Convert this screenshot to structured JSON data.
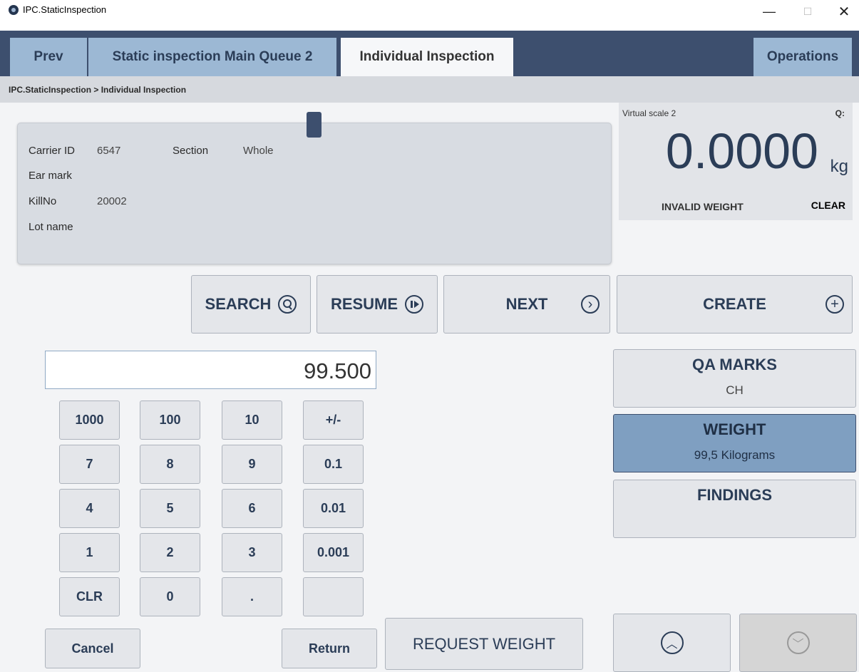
{
  "window": {
    "title": "IPC.StaticInspection",
    "minimize": "—",
    "maximize": "☐",
    "close": "✕"
  },
  "tabs": {
    "prev": "Prev",
    "queue": "Static inspection Main Queue 2",
    "individual": "Individual Inspection",
    "operations": "Operations"
  },
  "breadcrumb": "IPC.StaticInspection > Individual Inspection",
  "carrier": {
    "carrier_id_label": "Carrier ID",
    "carrier_id_value": "6547",
    "section_label": "Section",
    "section_value": "Whole",
    "ear_mark_label": "Ear mark",
    "kill_no_label": "KillNo",
    "kill_no_value": "20002",
    "lot_name_label": "Lot name"
  },
  "scale": {
    "name": "Virtual scale 2",
    "q_label": "Q:",
    "weight": "0.0000",
    "unit": "kg",
    "status": "INVALID WEIGHT",
    "clear": "CLEAR"
  },
  "actions": {
    "search": "SEARCH",
    "resume": "RESUME",
    "next": "NEXT",
    "create": "CREATE"
  },
  "entry": {
    "value": "99.500"
  },
  "keypad": {
    "k1000": "1000",
    "k100": "100",
    "k10": "10",
    "kpm": "+/-",
    "k7": "7",
    "k8": "8",
    "k9": "9",
    "k01": "0.1",
    "k4": "4",
    "k5": "5",
    "k6": "6",
    "k001": "0.01",
    "k1": "1",
    "k2": "2",
    "k3": "3",
    "k0001": "0.001",
    "kclr": "CLR",
    "k0": "0",
    "kdot": ".",
    "kblank": ""
  },
  "bottom": {
    "cancel": "Cancel",
    "return": "Return",
    "request_weight": "REQUEST WEIGHT"
  },
  "side": {
    "qa_marks_title": "QA MARKS",
    "qa_marks_value": "CH",
    "weight_title": "WEIGHT",
    "weight_value": "99,5 Kilograms",
    "findings_title": "FINDINGS"
  },
  "icons": {
    "up": "chevron-up-icon",
    "down": "chevron-down-icon",
    "plus": "plus-icon",
    "next": "chevron-right-icon"
  },
  "colors": {
    "accent_dark": "#3d4f6e",
    "tab_inactive": "#9cb8d4",
    "active_side": "#7f9fc1"
  }
}
